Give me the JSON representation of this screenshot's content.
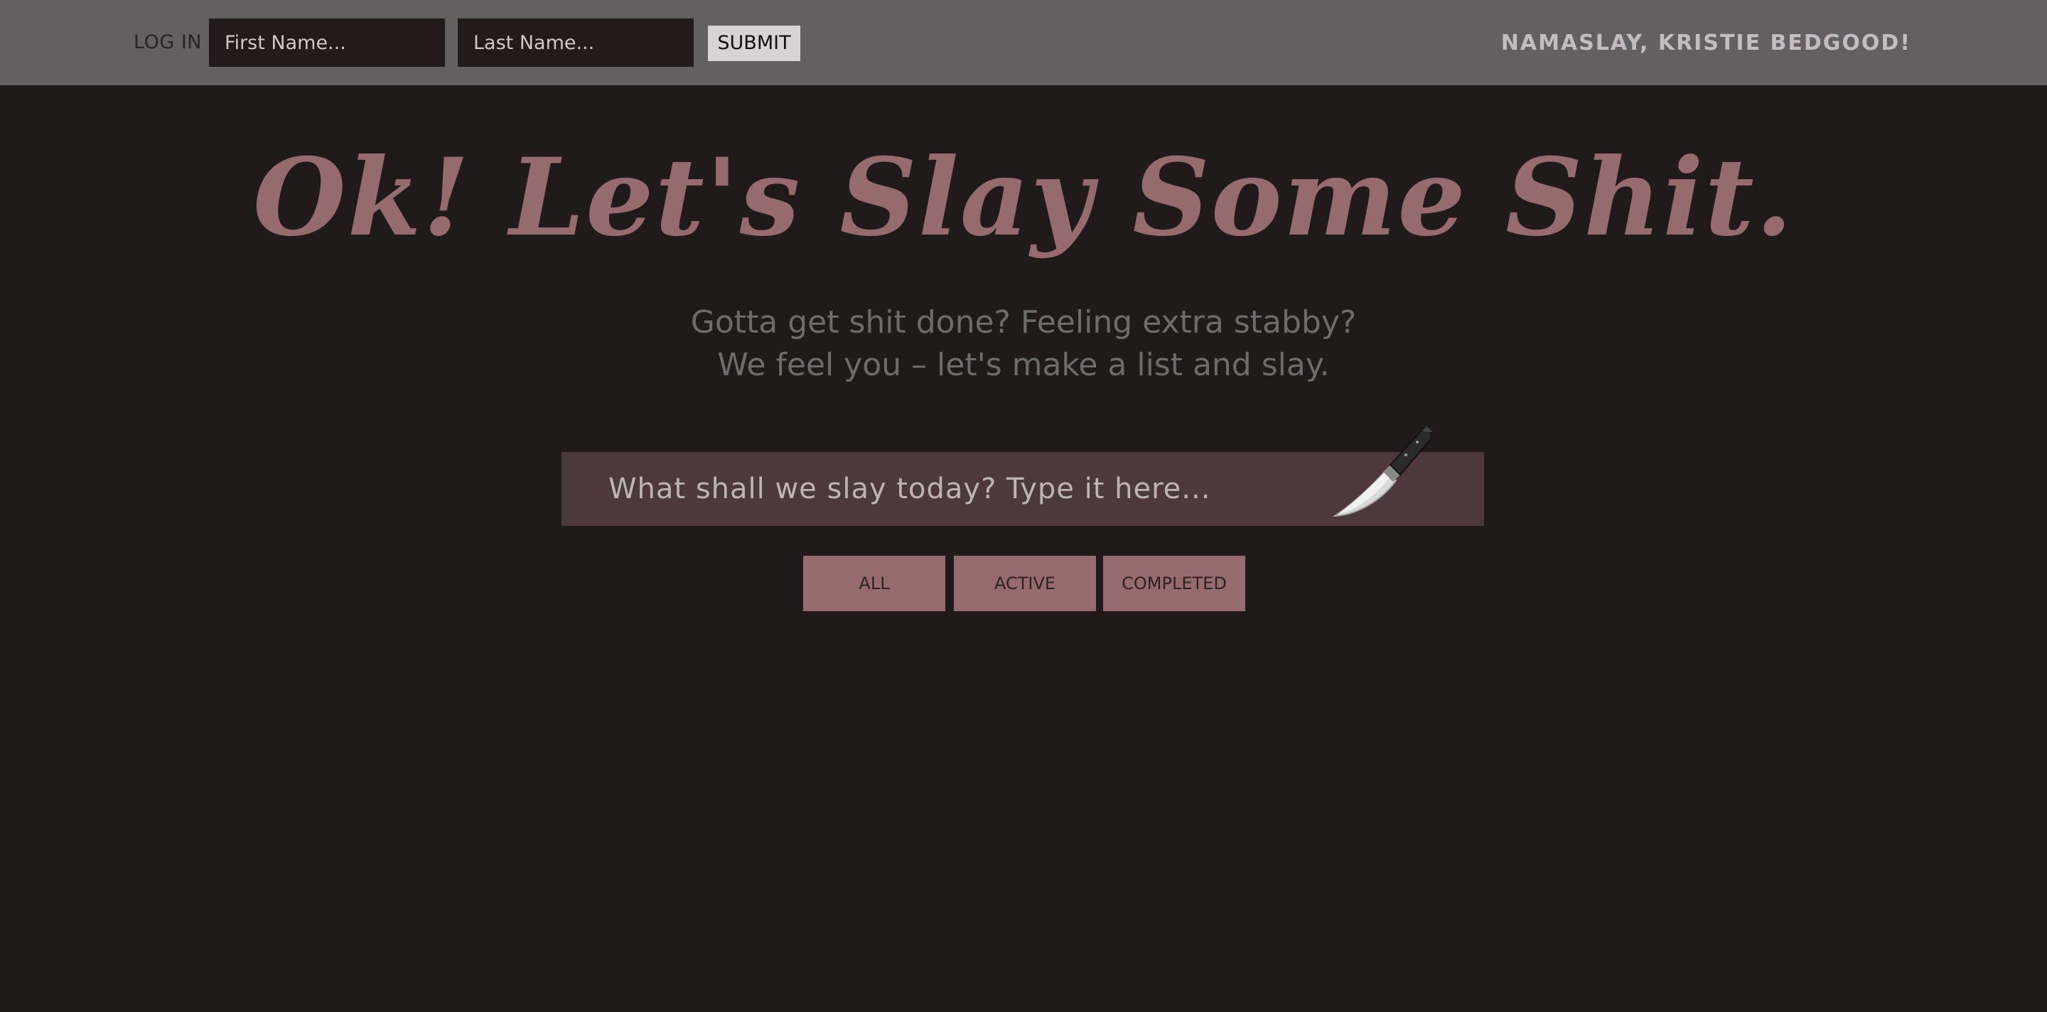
{
  "header": {
    "login_label": "LOG IN",
    "first_name_placeholder": "First Name...",
    "last_name_placeholder": "Last Name...",
    "submit_label": "SUBMIT",
    "greeting": "NAMASLAY, KRISTIE BEDGOOD!"
  },
  "hero": {
    "title": "Ok! Let's Slay Some Shit.",
    "subtitle_line1": "Gotta get shit done? Feeling extra stabby?",
    "subtitle_line2": "We feel you – let's make a list and slay."
  },
  "task": {
    "placeholder": "What shall we slay today? Type it here...",
    "icon": "knife-icon"
  },
  "filters": {
    "all": "ALL",
    "active": "ACTIVE",
    "completed": "COMPLETED"
  },
  "colors": {
    "background": "#211a1b",
    "topbar": "#645f60",
    "accent": "#966b6d",
    "task_box": "#4c383d"
  }
}
